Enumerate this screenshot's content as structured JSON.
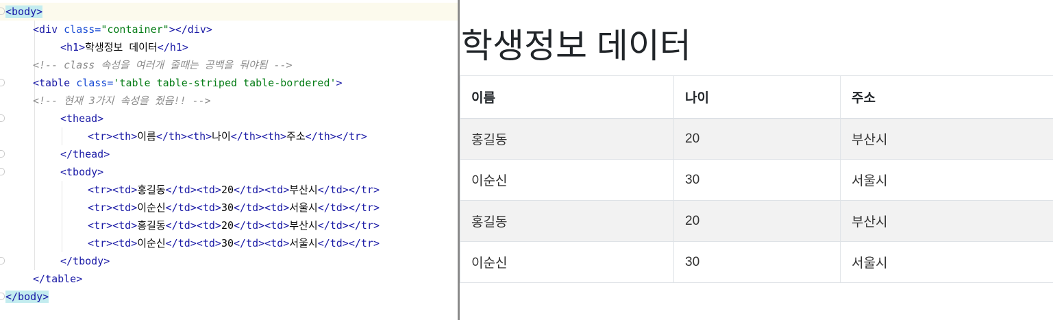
{
  "editor": {
    "lines": [
      [
        {
          "t": "tag-hl",
          "v": "<body>"
        }
      ],
      [
        {
          "t": "tag",
          "v": "<div "
        },
        {
          "t": "attr",
          "v": "class="
        },
        {
          "t": "str",
          "v": "\"container\""
        },
        {
          "t": "tag",
          "v": "></div>"
        }
      ],
      [
        {
          "t": "tag",
          "v": "<h1>"
        },
        {
          "t": "txt",
          "v": "학생정보 데이터"
        },
        {
          "t": "tag",
          "v": "</h1>"
        }
      ],
      [
        {
          "t": "cmt",
          "v": "<!-- class 속성을 여러개 줄때는 공백을 둬야됨 -->"
        }
      ],
      [
        {
          "t": "tag",
          "v": "<table "
        },
        {
          "t": "attr",
          "v": "class="
        },
        {
          "t": "str",
          "v": "'table table-striped table-bordered'"
        },
        {
          "t": "tag",
          "v": ">"
        }
      ],
      [
        {
          "t": "cmt",
          "v": "<!-- 현재 3가지 속성을 줬음!! -->"
        }
      ],
      [
        {
          "t": "tag",
          "v": "<thead>"
        }
      ],
      [
        {
          "t": "tag",
          "v": "<tr><th>"
        },
        {
          "t": "txt",
          "v": "이름"
        },
        {
          "t": "tag",
          "v": "</th><th>"
        },
        {
          "t": "txt",
          "v": "나이"
        },
        {
          "t": "tag",
          "v": "</th><th>"
        },
        {
          "t": "txt",
          "v": "주소"
        },
        {
          "t": "tag",
          "v": "</th></tr>"
        }
      ],
      [
        {
          "t": "tag",
          "v": "</thead>"
        }
      ],
      [
        {
          "t": "tag",
          "v": "<tbody>"
        }
      ],
      [
        {
          "t": "tag",
          "v": "<tr><td>"
        },
        {
          "t": "txt",
          "v": "홍길동"
        },
        {
          "t": "tag",
          "v": "</td><td>"
        },
        {
          "t": "txt",
          "v": "20"
        },
        {
          "t": "tag",
          "v": "</td><td>"
        },
        {
          "t": "txt",
          "v": "부산시"
        },
        {
          "t": "tag",
          "v": "</td></tr>"
        }
      ],
      [
        {
          "t": "tag",
          "v": "<tr><td>"
        },
        {
          "t": "txt",
          "v": "이순신"
        },
        {
          "t": "tag",
          "v": "</td><td>"
        },
        {
          "t": "txt",
          "v": "30"
        },
        {
          "t": "tag",
          "v": "</td><td>"
        },
        {
          "t": "txt",
          "v": "서울시"
        },
        {
          "t": "tag",
          "v": "</td></tr>"
        }
      ],
      [
        {
          "t": "tag",
          "v": "<tr><td>"
        },
        {
          "t": "txt",
          "v": "홍길동"
        },
        {
          "t": "tag",
          "v": "</td><td>"
        },
        {
          "t": "txt",
          "v": "20"
        },
        {
          "t": "tag",
          "v": "</td><td>"
        },
        {
          "t": "txt",
          "v": "부산시"
        },
        {
          "t": "tag",
          "v": "</td></tr>"
        }
      ],
      [
        {
          "t": "tag",
          "v": "<tr><td>"
        },
        {
          "t": "txt",
          "v": "이순신"
        },
        {
          "t": "tag",
          "v": "</td><td>"
        },
        {
          "t": "txt",
          "v": "30"
        },
        {
          "t": "tag",
          "v": "</td><td>"
        },
        {
          "t": "txt",
          "v": "서울시"
        },
        {
          "t": "tag",
          "v": "</td></tr>"
        }
      ],
      [
        {
          "t": "tag",
          "v": "</tbody>"
        }
      ],
      [
        {
          "t": "tag",
          "v": "</table>"
        }
      ],
      [
        {
          "t": "tag-hl",
          "v": "</body>"
        }
      ]
    ]
  },
  "preview": {
    "heading": "학생정보 데이터",
    "table": {
      "headers": [
        "이름",
        "나이",
        "주소"
      ],
      "rows": [
        [
          "홍길동",
          "20",
          "부산시"
        ],
        [
          "이순신",
          "30",
          "서울시"
        ],
        [
          "홍길동",
          "20",
          "부산시"
        ],
        [
          "이순신",
          "30",
          "서울시"
        ]
      ]
    }
  }
}
